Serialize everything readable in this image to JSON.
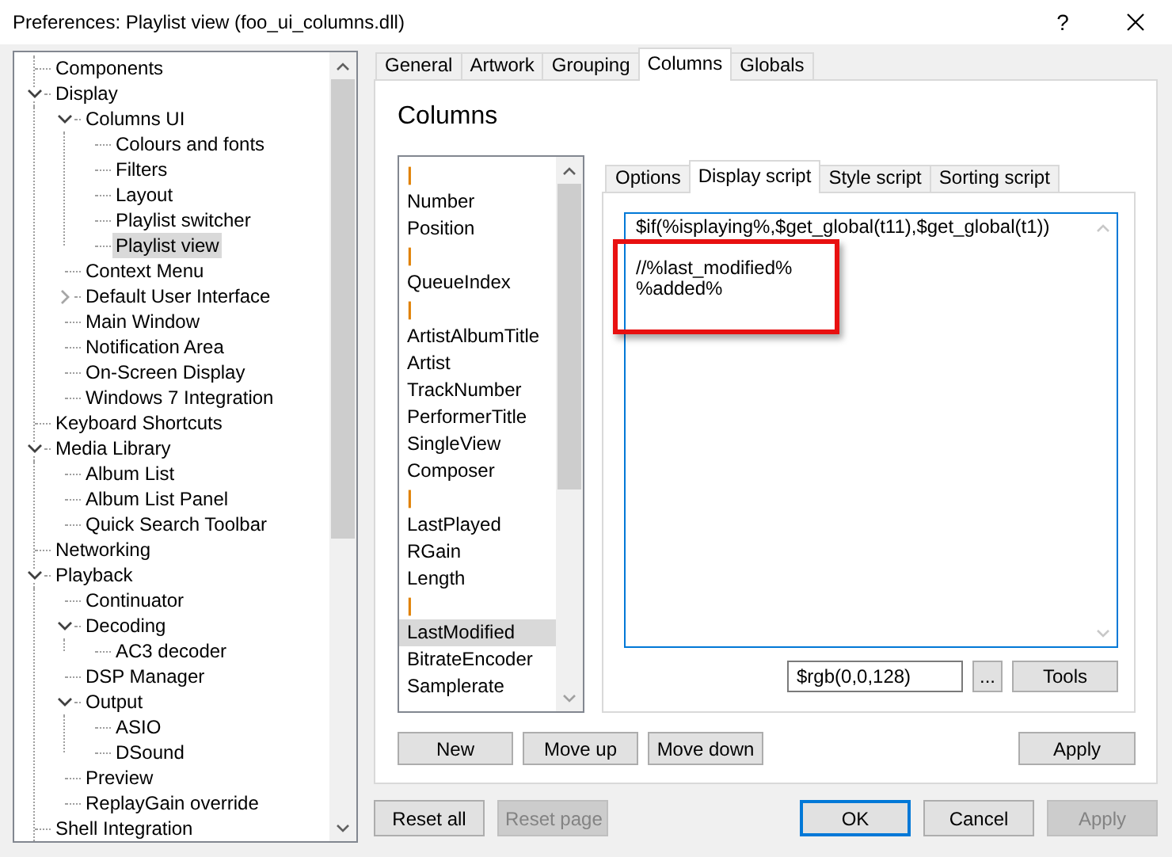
{
  "window": {
    "title": "Preferences: Playlist view (foo_ui_columns.dll)",
    "help": "?"
  },
  "tree": {
    "items": [
      {
        "label": "Components",
        "selected": false
      },
      {
        "label": "Display",
        "selected": false,
        "expanded": true,
        "children": [
          {
            "label": "Columns UI",
            "selected": false,
            "expanded": true,
            "children": [
              {
                "label": "Colours and fonts",
                "selected": false
              },
              {
                "label": "Filters",
                "selected": false
              },
              {
                "label": "Layout",
                "selected": false
              },
              {
                "label": "Playlist switcher",
                "selected": false
              },
              {
                "label": "Playlist view",
                "selected": true
              }
            ]
          },
          {
            "label": "Context Menu",
            "selected": false
          },
          {
            "label": "Default User Interface",
            "selected": false,
            "expanded": false
          },
          {
            "label": "Main Window",
            "selected": false
          },
          {
            "label": "Notification Area",
            "selected": false
          },
          {
            "label": "On-Screen Display",
            "selected": false
          },
          {
            "label": "Windows 7 Integration",
            "selected": false
          }
        ]
      },
      {
        "label": "Keyboard Shortcuts",
        "selected": false
      },
      {
        "label": "Media Library",
        "selected": false,
        "expanded": true,
        "children": [
          {
            "label": "Album List",
            "selected": false
          },
          {
            "label": "Album List Panel",
            "selected": false
          },
          {
            "label": "Quick Search Toolbar",
            "selected": false
          }
        ]
      },
      {
        "label": "Networking",
        "selected": false
      },
      {
        "label": "Playback",
        "selected": false,
        "expanded": true,
        "children": [
          {
            "label": "Continuator",
            "selected": false
          },
          {
            "label": "Decoding",
            "selected": false,
            "expanded": true,
            "children": [
              {
                "label": "AC3 decoder",
                "selected": false
              }
            ]
          },
          {
            "label": "DSP Manager",
            "selected": false
          },
          {
            "label": "Output",
            "selected": false,
            "expanded": true,
            "children": [
              {
                "label": "ASIO",
                "selected": false
              },
              {
                "label": "DSound",
                "selected": false
              }
            ]
          },
          {
            "label": "Preview",
            "selected": false
          },
          {
            "label": "ReplayGain override",
            "selected": false
          }
        ]
      },
      {
        "label": "Shell Integration",
        "selected": false
      }
    ]
  },
  "tabs": [
    {
      "label": "General",
      "selected": false
    },
    {
      "label": "Artwork",
      "selected": false
    },
    {
      "label": "Grouping",
      "selected": false
    },
    {
      "label": "Columns",
      "selected": true
    },
    {
      "label": "Globals",
      "selected": false
    }
  ],
  "page": {
    "title": "Columns",
    "columns": [
      {
        "label": "|",
        "kind": "separator",
        "selected": false
      },
      {
        "label": "Number",
        "kind": "column",
        "selected": false
      },
      {
        "label": "Position",
        "kind": "column",
        "selected": false
      },
      {
        "label": "|",
        "kind": "separator",
        "selected": false
      },
      {
        "label": "QueueIndex",
        "kind": "column",
        "selected": false
      },
      {
        "label": "|",
        "kind": "separator",
        "selected": false
      },
      {
        "label": "ArtistAlbumTitle",
        "kind": "column",
        "selected": false
      },
      {
        "label": "Artist",
        "kind": "column",
        "selected": false
      },
      {
        "label": "TrackNumber",
        "kind": "column",
        "selected": false
      },
      {
        "label": "PerformerTitle",
        "kind": "column",
        "selected": false
      },
      {
        "label": "SingleView",
        "kind": "column",
        "selected": false
      },
      {
        "label": "Composer",
        "kind": "column",
        "selected": false
      },
      {
        "label": "|",
        "kind": "separator",
        "selected": false
      },
      {
        "label": "LastPlayed",
        "kind": "column",
        "selected": false
      },
      {
        "label": "RGain",
        "kind": "column",
        "selected": false
      },
      {
        "label": "Length",
        "kind": "column",
        "selected": false
      },
      {
        "label": "|",
        "kind": "separator",
        "selected": false
      },
      {
        "label": "LastModified",
        "kind": "column",
        "selected": true
      },
      {
        "label": "BitrateEncoder",
        "kind": "column",
        "selected": false
      },
      {
        "label": "Samplerate",
        "kind": "column",
        "selected": false
      }
    ],
    "subtabs": [
      {
        "label": "Options",
        "selected": false
      },
      {
        "label": "Display script",
        "selected": true
      },
      {
        "label": "Style script",
        "selected": false
      },
      {
        "label": "Sorting script",
        "selected": false
      }
    ],
    "script_blocks": [
      {
        "lines": [
          "$if(%isplaying%,$get_global(t11),$get_global(t1))"
        ],
        "highlighted": false
      },
      {
        "lines": [
          "//%last_modified%",
          "%added%"
        ],
        "highlighted": true
      }
    ],
    "color_field": {
      "value": "$rgb(0,0,128)"
    },
    "pick_button": "...",
    "tools_button": "Tools",
    "buttons": [
      {
        "label": "New",
        "disabled": false
      },
      {
        "label": "Move up",
        "disabled": false
      },
      {
        "label": "Move down",
        "disabled": false
      }
    ],
    "apply_button": {
      "label": "Apply",
      "disabled": false
    }
  },
  "footer": {
    "left": [
      {
        "label": "Reset all",
        "disabled": false,
        "default": false
      },
      {
        "label": "Reset page",
        "disabled": true,
        "default": false
      }
    ],
    "right": [
      {
        "label": "OK",
        "disabled": false,
        "default": true
      },
      {
        "label": "Cancel",
        "disabled": false,
        "default": false
      },
      {
        "label": "Apply",
        "disabled": true,
        "default": false
      }
    ]
  }
}
